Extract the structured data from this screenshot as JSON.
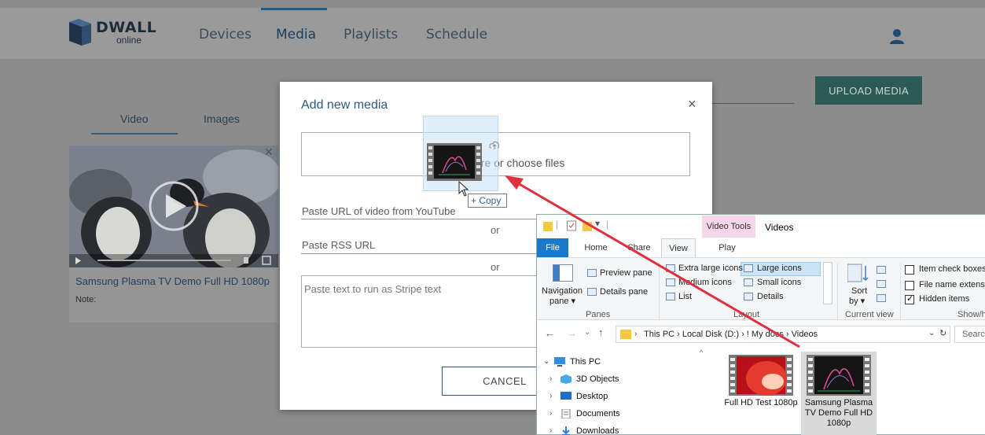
{
  "app": {
    "brand": "DWALL",
    "brand_sub": "online",
    "nav": [
      "Devices",
      "Media",
      "Playlists",
      "Schedule"
    ],
    "upload_label": "UPLOAD MEDIA",
    "tabs": [
      "Video",
      "Images"
    ],
    "card": {
      "title": "Samsung Plasma TV Demo Full HD 1080p",
      "note": "Note:",
      "close": "✕"
    }
  },
  "modal": {
    "title": "Add new media",
    "close": "×",
    "drop_text": "ere or choose files",
    "youtube_label": "Paste URL of video from YouTube",
    "or1": "or",
    "rss_label": "Paste RSS URL",
    "or2": "or",
    "stripe_placeholder": "Paste text to run as Stripe text",
    "cancel_label": "CANCEL",
    "copy_badge": "+ Copy"
  },
  "explorer": {
    "context_tab": "Video Tools",
    "window_title": "Videos",
    "tabs": [
      "File",
      "Home",
      "Share",
      "View",
      "Play"
    ],
    "ribbon": {
      "preview_pane": "Preview pane",
      "details_pane": "Details pane",
      "navigation_pane": "Navigation",
      "navigation_pane2": "pane ▾",
      "panes_group": "Panes",
      "extra_large": "Extra large icons",
      "large_icons": "Large icons",
      "medium_icons": "Medium icons",
      "small_icons": "Small icons",
      "list": "List",
      "details": "Details",
      "layout_group": "Layout",
      "sort_by": "Sort",
      "sort_by2": "by ▾",
      "current_view_group": "Current view",
      "item_check_boxes": "Item check boxes",
      "file_name_ext": "File name extensio",
      "hidden_items": "Hidden items",
      "show_hide_group": "Show/h"
    },
    "address": "This PC  ›  Local Disk (D:)  ›  ! My docs  ›  Videos",
    "search_placeholder": "Searc",
    "tree": [
      "This PC",
      "3D Objects",
      "Desktop",
      "Documents",
      "Downloads"
    ],
    "files": [
      {
        "name": "Full HD Test 1080p"
      },
      {
        "name": "Samsung Plasma TV Demo Full HD 1080p"
      }
    ]
  },
  "colors": {
    "accent": "#2c5a82",
    "upload_bg": "#2c5b56",
    "file_tab": "#1979ca",
    "arrow": "#e0303e",
    "context_tab": "#f7d5ea"
  }
}
